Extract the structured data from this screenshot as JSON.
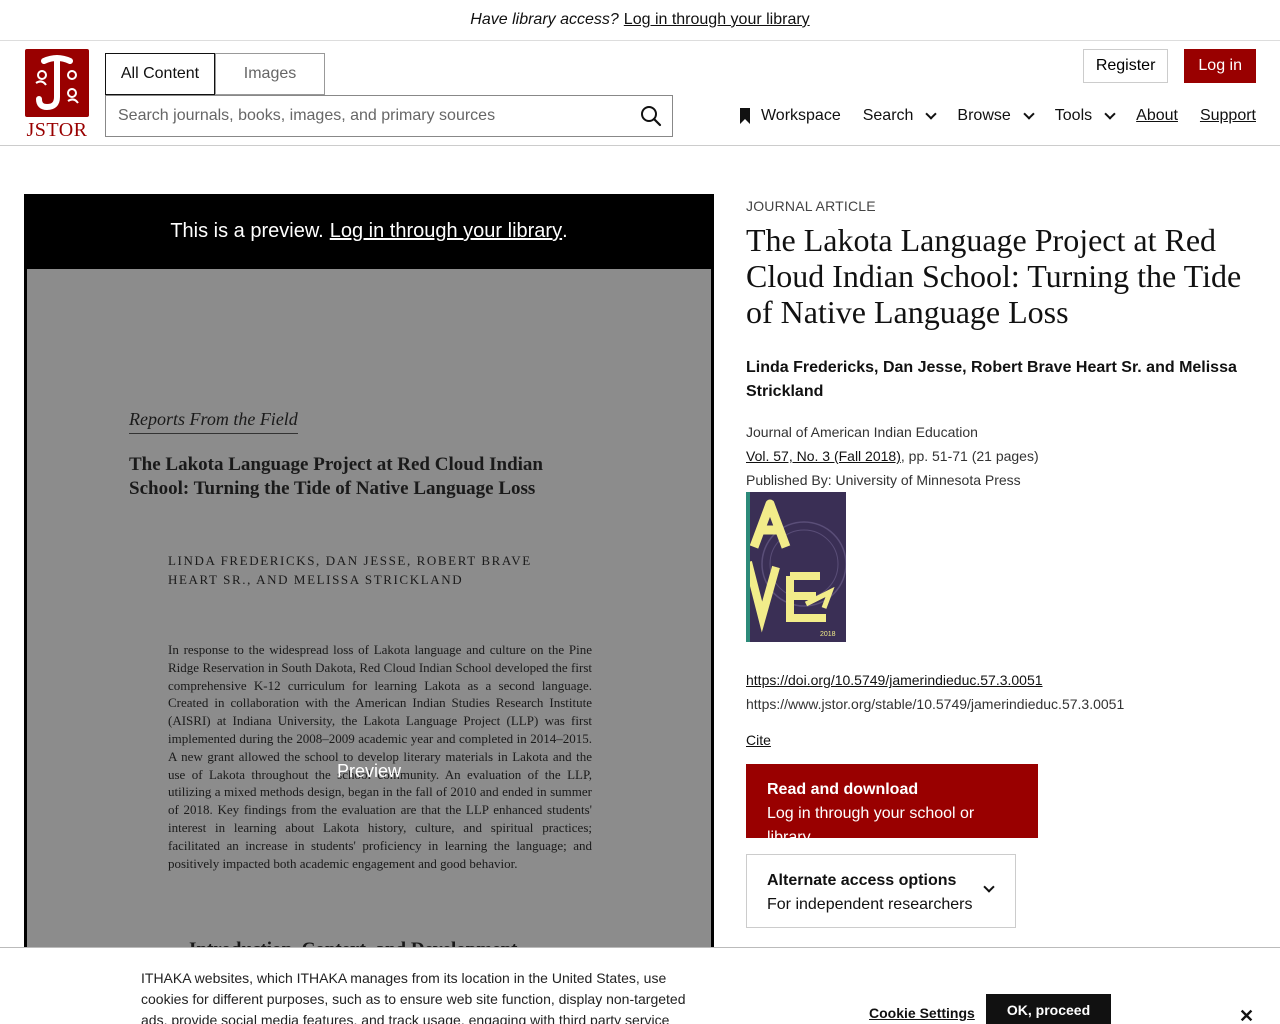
{
  "banner": {
    "question": "Have library access?",
    "link": "Log in through your library"
  },
  "logo": {
    "text": "JSTOR"
  },
  "scope_tabs": [
    "All Content",
    "Images"
  ],
  "search": {
    "placeholder": "Search journals, books, images, and primary sources"
  },
  "auth": {
    "register": "Register",
    "login": "Log in"
  },
  "nav": {
    "workspace": "Workspace",
    "search": "Search",
    "browse": "Browse",
    "tools": "Tools",
    "about": "About",
    "support": "Support"
  },
  "preview": {
    "notice": "This is a preview.",
    "notice_link": "Log in through your library",
    "notice_end": ".",
    "watermark": "Preview",
    "page": {
      "kicker": "Reports From the Field",
      "title": "The Lakota Language Project at Red Cloud Indian School: Turning the Tide of Native Language Loss",
      "authors": "Linda Fredericks, Dan Jesse, Robert Brave Heart Sr., and Melissa Strickland",
      "abstract": "In response to the widespread loss of Lakota language and culture on the Pine Ridge Reservation in South Dakota, Red Cloud Indian School developed the first comprehensive K-12 curriculum for learning Lakota as a second language. Created in collaboration with the American Indian Studies Research Institute (AISRI) at Indiana University, the Lakota Language Project (LLP) was first implemented during the 2008–2009 academic year and completed in 2014–2015. A new grant allowed the school to develop literary materials in Lakota and the use of Lakota throughout the school community. An evaluation of the LLP, utilizing a mixed methods design, began in the fall of 2010 and ended in summer of 2018. Key findings from the evaluation are that the LLP enhanced students' interest in learning about Lakota history, culture, and spiritual practices; facilitated an increase in students' proficiency in learning the language; and positively impacted both academic engagement and good behavior.",
      "next_heading": "Introduction, Context, and Development"
    }
  },
  "article": {
    "type": "Journal Article",
    "title": "The Lakota Language Project at Red Cloud Indian School: Turning the Tide of Native Language Loss",
    "authors": "Linda Fredericks, Dan Jesse, Robert Brave Heart Sr. and Melissa Strickland",
    "journal": "Journal of American Indian Education",
    "issue_link": "Vol. 57, No. 3 (Fall 2018)",
    "pages": ", pp. 51-71 (21 pages)",
    "publisher": "Published By: University of Minnesota Press",
    "cover_year": "2018",
    "doi": "https://doi.org/10.5749/jamerindieduc.57.3.0051",
    "stable_url": "https://www.jstor.org/stable/10.5749/jamerindieduc.57.3.0051",
    "cite": "Cite",
    "read_title": "Read and download",
    "read_sub": "Log in through your school or library",
    "alt_title": "Alternate access options",
    "alt_sub": "For independent researchers"
  },
  "cookie": {
    "text": "ITHAKA websites, which ITHAKA manages from its location in the United States, use cookies for different purposes, such as to ensure web site function, display non-targeted ads, provide social media features, and track usage, engaging with third party service",
    "settings": "Cookie Settings",
    "ok": "OK, proceed",
    "close": "✕"
  },
  "colors": {
    "brand": "#990000",
    "preview_bg": "#000000",
    "page_bg": "#8c8c8c",
    "cover_bg": "#3a2f55",
    "cover_accent": "#f2ec8a"
  }
}
